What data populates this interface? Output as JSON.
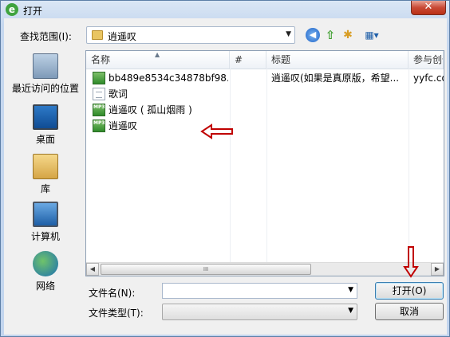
{
  "window": {
    "title": "打开",
    "app_icon_glyph": "e",
    "close_glyph": "✕"
  },
  "lookin": {
    "label": "查找范围(I):",
    "value": "逍遥叹"
  },
  "places": [
    {
      "label": "最近访问的位置",
      "icon": "recent-places-icon"
    },
    {
      "label": "桌面",
      "icon": "desktop-icon"
    },
    {
      "label": "库",
      "icon": "library-icon"
    },
    {
      "label": "计算机",
      "icon": "computer-icon"
    },
    {
      "label": "网络",
      "icon": "network-icon"
    }
  ],
  "columns": [
    "名称",
    "#",
    "标题",
    "参与创作"
  ],
  "files": [
    {
      "name": "bb489e8534c34878bf98...",
      "title": "逍遥叹(如果是真原版，希望...",
      "artist": "yyfc.co",
      "type": "audio"
    },
    {
      "name": "歌词",
      "title": "",
      "artist": "",
      "type": "text"
    },
    {
      "name": "逍遥叹 ( 孤山烟雨 )",
      "title": "",
      "artist": "",
      "type": "mp3"
    },
    {
      "name": "逍遥叹",
      "title": "",
      "artist": "",
      "type": "mp3"
    }
  ],
  "file_icon_badge": "MP3",
  "scroll_grip": "III",
  "filename": {
    "label": "文件名(N):",
    "value": ""
  },
  "filetype": {
    "label": "文件类型(T):",
    "value": ""
  },
  "buttons": {
    "open": "打开(O)",
    "cancel": "取消"
  },
  "colors": {
    "annotation_arrow": "#c00000",
    "titlebar": "#c6d8ef",
    "close_button": "#c94a36"
  }
}
